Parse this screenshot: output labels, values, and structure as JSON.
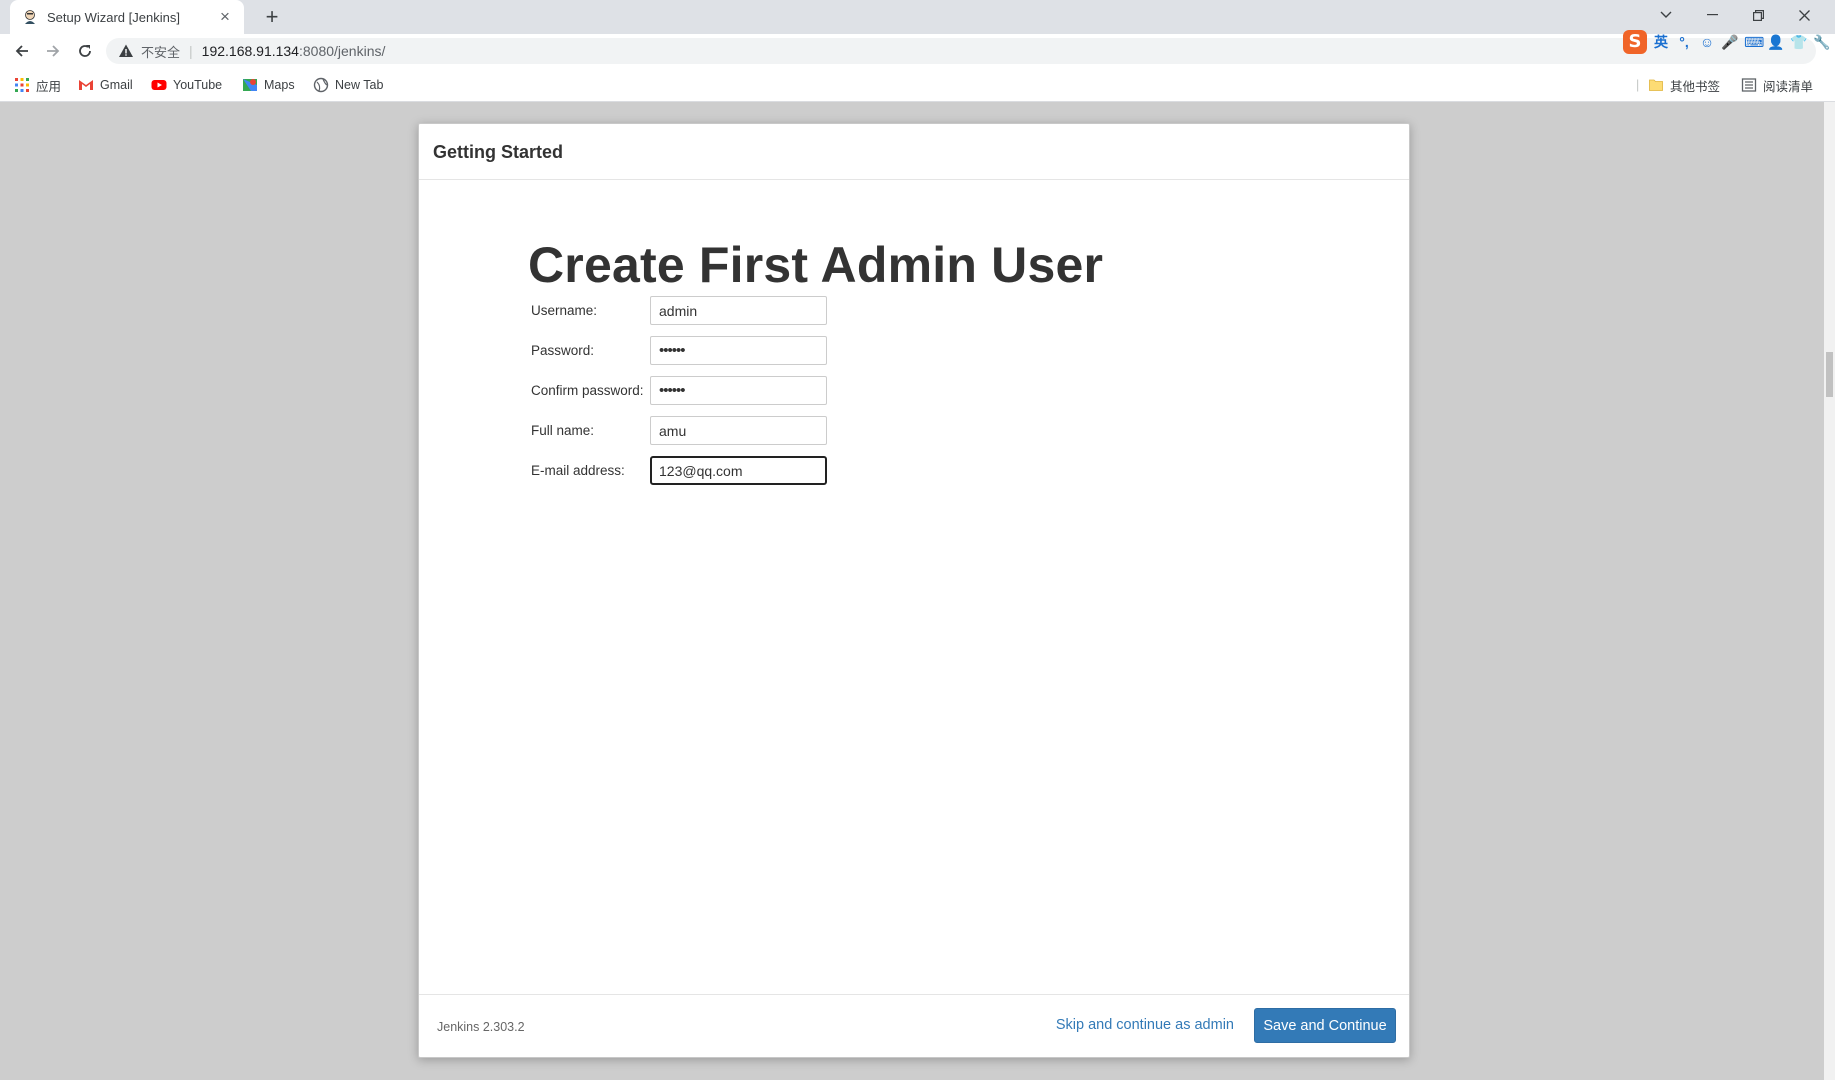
{
  "browser": {
    "tab_title": "Setup Wizard [Jenkins]",
    "insecure_label": "不安全",
    "url_host": "192.168.91.134",
    "url_path": ":8080/jenkins/",
    "ime_items": [
      "英",
      "°,",
      "☺",
      "🎤",
      "⌨",
      "👤",
      "👕",
      "🔧"
    ]
  },
  "bookmarks": {
    "apps": "应用",
    "gmail": "Gmail",
    "youtube": "YouTube",
    "maps": "Maps",
    "newtab": "New Tab",
    "other": "其他书签",
    "reading": "阅读清单"
  },
  "dialog": {
    "title": "Getting Started",
    "heading": "Create First Admin User",
    "fields": [
      {
        "label": "Username:",
        "value": "admin"
      },
      {
        "label": "Password:",
        "value": "••••••"
      },
      {
        "label": "Confirm password:",
        "value": "••••••"
      },
      {
        "label": "Full name:",
        "value": "amu"
      },
      {
        "label": "E-mail address:",
        "value": "123@qq.com"
      }
    ],
    "version": "Jenkins 2.303.2",
    "skip_label": "Skip and continue as admin",
    "save_label": "Save and Continue"
  },
  "colors": {
    "primary": "#337ab7",
    "page_bg": "#cdcdcd"
  }
}
